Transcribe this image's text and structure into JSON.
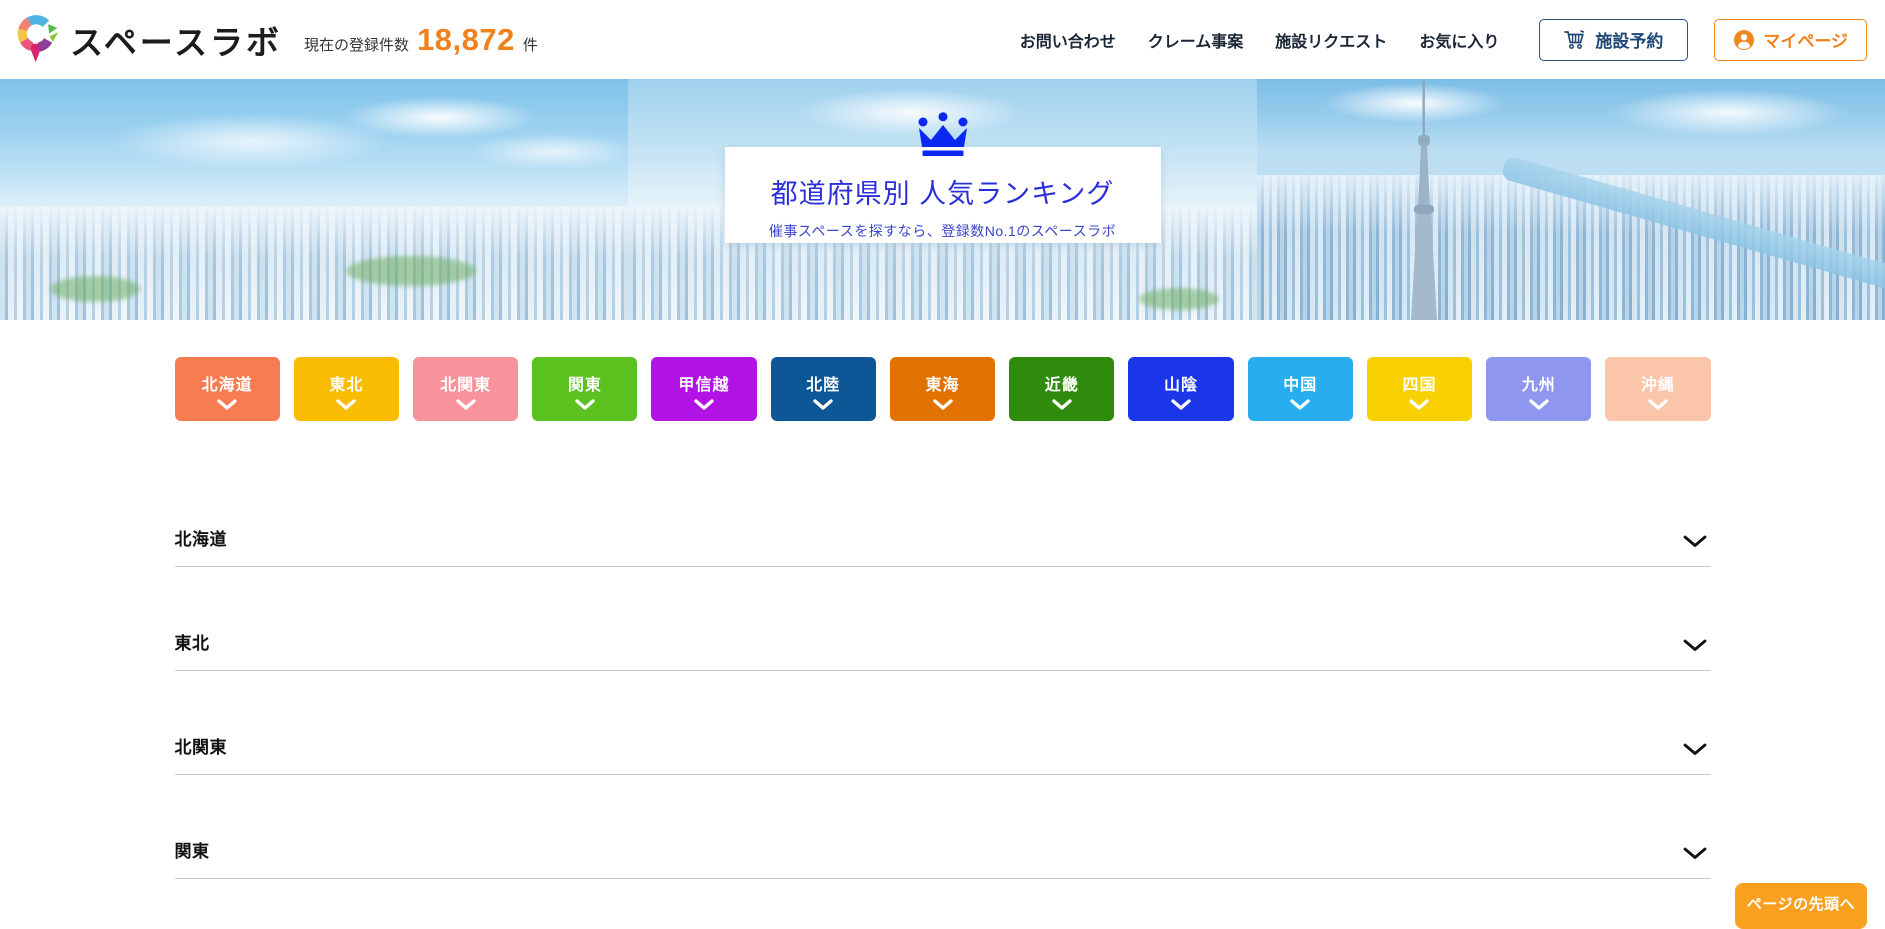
{
  "header": {
    "logo": {
      "text": "スペースラボ",
      "icon": "spacelab-pin-logo"
    },
    "registration": {
      "label": "現在の登録件数",
      "value": "18,872",
      "unit": "件"
    },
    "nav_items": [
      {
        "label": "お問い合わせ"
      },
      {
        "label": "クレーム事案"
      },
      {
        "label": "施設リクエスト"
      },
      {
        "label": "お気に入り"
      }
    ],
    "reserve_button": {
      "label": "施設予約",
      "icon": "cart-icon",
      "color": "#1f4778"
    },
    "mypage_button": {
      "label": "マイページ",
      "icon": "user-icon",
      "color": "#f0821c"
    }
  },
  "hero": {
    "icon": "crown-icon",
    "crown_color": "#0a28f0",
    "title": "都道府県別 人気ランキング",
    "title_color": "#2b2fd9",
    "subtitle": "催事スペースを探すなら、登録数No.1のスペースラボ",
    "subtitle_color": "#3a44cc"
  },
  "region_buttons": [
    {
      "label": "北海道",
      "color": "#f87c52"
    },
    {
      "label": "東北",
      "color": "#f9bc02"
    },
    {
      "label": "北関東",
      "color": "#f9939b"
    },
    {
      "label": "関東",
      "color": "#5bc11f"
    },
    {
      "label": "甲信越",
      "color": "#b013e3"
    },
    {
      "label": "北陸",
      "color": "#0d5796"
    },
    {
      "label": "東海",
      "color": "#e17200"
    },
    {
      "label": "近畿",
      "color": "#2f8b0c"
    },
    {
      "label": "山陰",
      "color": "#1a36e8"
    },
    {
      "label": "中国",
      "color": "#28adf1"
    },
    {
      "label": "四国",
      "color": "#f9d002"
    },
    {
      "label": "九州",
      "color": "#8e96f0"
    },
    {
      "label": "沖縄",
      "color": "#fbc5a9"
    }
  ],
  "accordion_sections": [
    {
      "label": "北海道",
      "icon": "chevron-down-icon"
    },
    {
      "label": "東北",
      "icon": "chevron-down-icon"
    },
    {
      "label": "北関東",
      "icon": "chevron-down-icon"
    },
    {
      "label": "関東",
      "icon": "chevron-down-icon"
    }
  ],
  "back_to_top": {
    "label": "ページの先頭へ",
    "color": "#f9a01f"
  }
}
